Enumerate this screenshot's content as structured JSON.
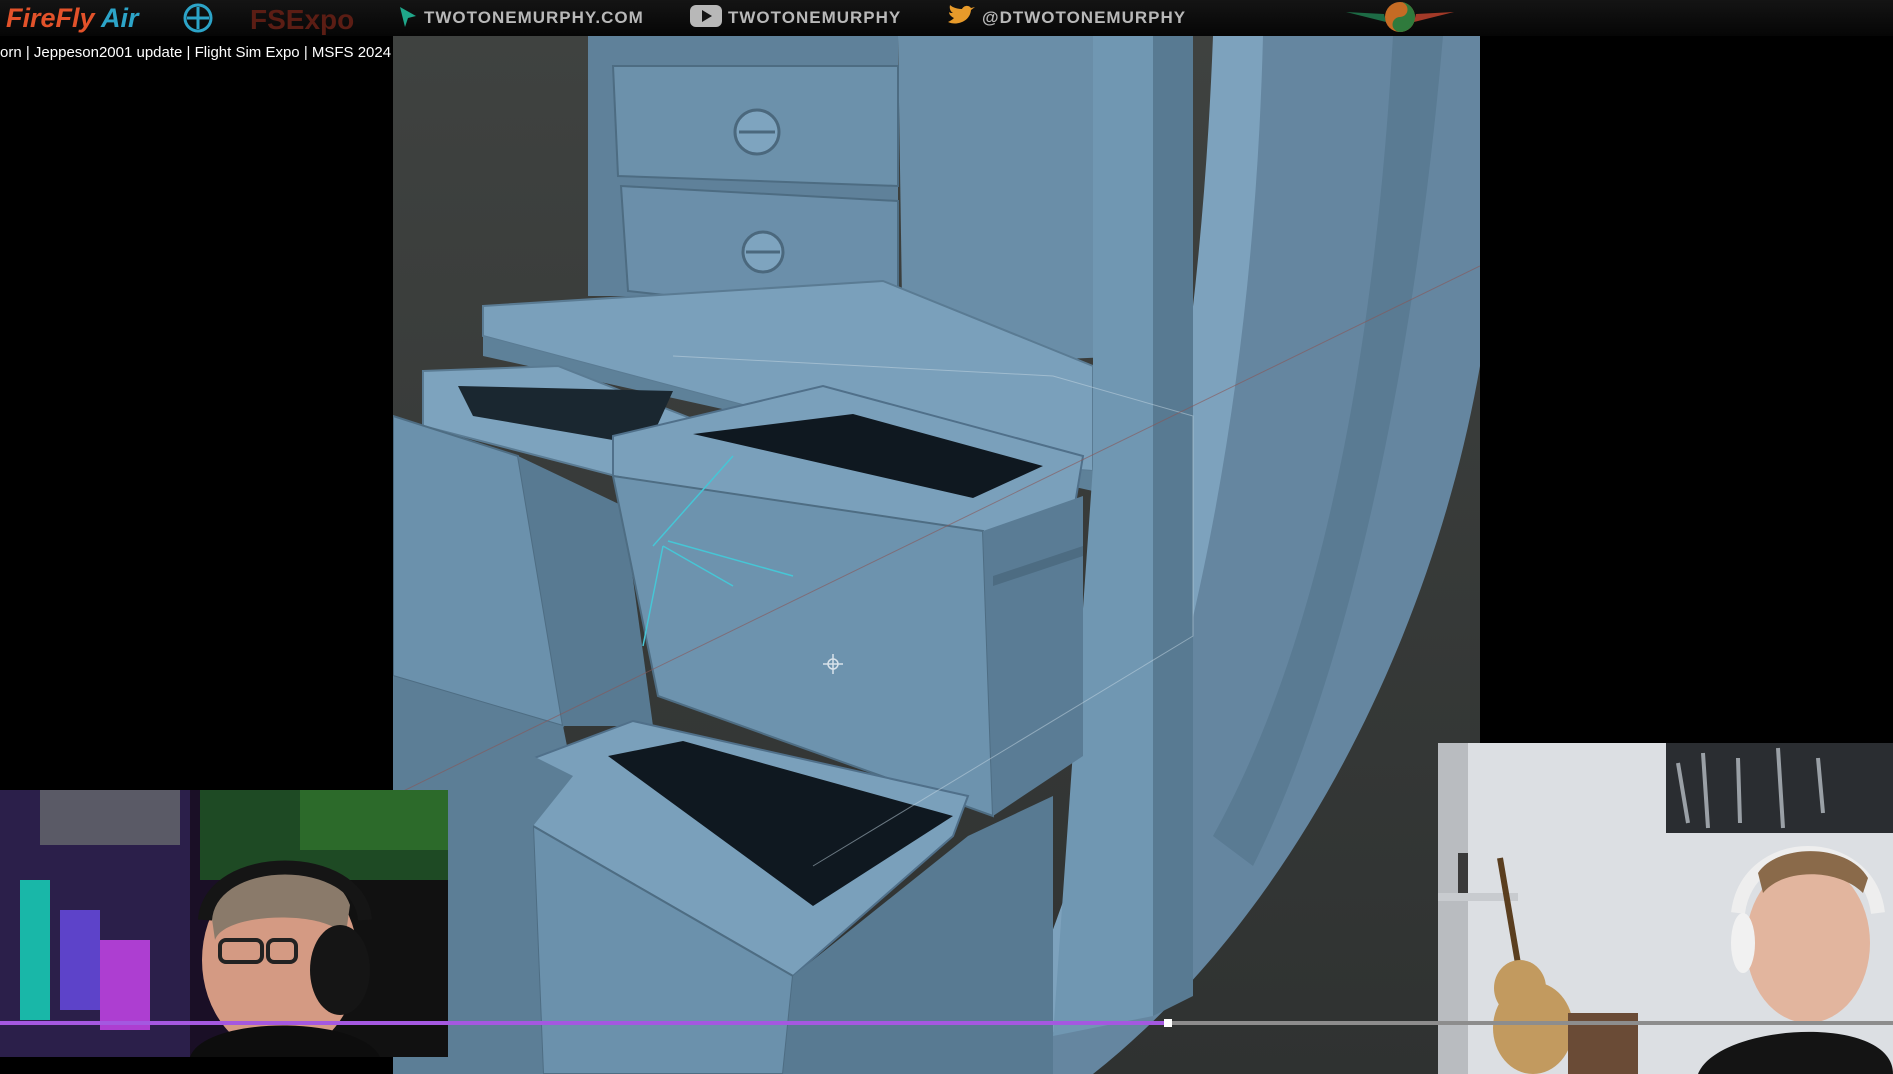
{
  "header": {
    "brand_fire": "FireFly",
    "brand_air": "Air",
    "brand_expo": "FSExpo",
    "website": "TWOTONEMURPHY.COM",
    "youtube": "TWOTONEMURPHY",
    "twitter": "@DTWOTONEMURPHY",
    "website_icon": "cursor-icon",
    "youtube_icon": "youtube-icon",
    "twitter_icon": "twitter-icon"
  },
  "video": {
    "title": "orn | Jeppeson2001 update | Flight Sim Expo | MSFS 2024",
    "progress": 0.617
  },
  "colors": {
    "accent_progress": "#a458e0",
    "model_blue": "#6d92ad",
    "brand_fire": "#e2522a",
    "brand_air": "#2ca4c8"
  }
}
